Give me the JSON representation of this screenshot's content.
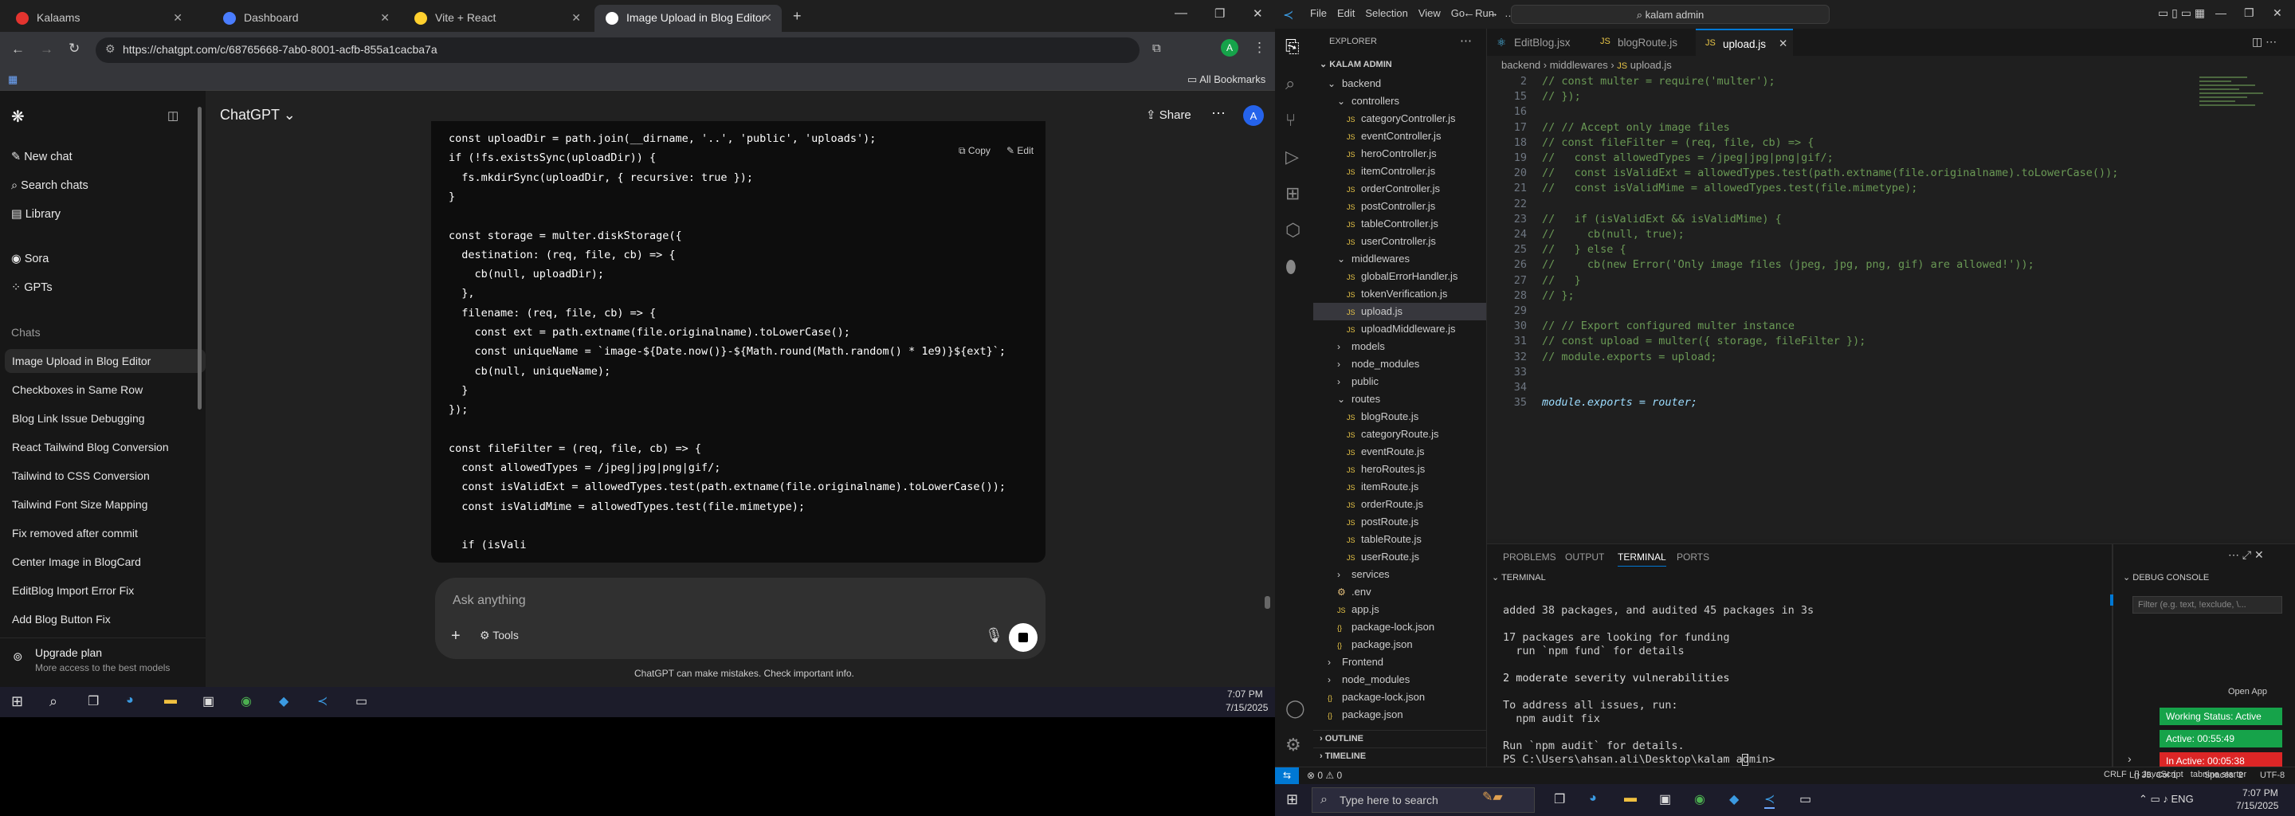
{
  "browser": {
    "tabs": [
      {
        "title": "Kalaams",
        "color": "#e3342f"
      },
      {
        "title": "Dashboard",
        "color": "#4a7dff"
      },
      {
        "title": "Vite + React",
        "color": "#ffd02e"
      },
      {
        "title": "Image Upload in Blog Editor",
        "color": "#ffffff"
      }
    ],
    "url": "https://chatgpt.com/c/68765668-7ab0-8001-acfb-855a1cacba7a",
    "all_bookmarks": "All Bookmarks"
  },
  "sidebar": {
    "nav": [
      "New chat",
      "Search chats",
      "Library",
      "Sora",
      "GPTs"
    ],
    "chats_heading": "Chats",
    "chats": [
      "Image Upload in Blog Editor",
      "Checkboxes in Same Row",
      "Blog Link Issue Debugging",
      "React Tailwind Blog Conversion",
      "Tailwind to CSS Conversion",
      "Tailwind Font Size Mapping",
      "Fix removed after commit",
      "Center Image in BlogCard",
      "EditBlog Import Error Fix",
      "Add Blog Button Fix"
    ],
    "upgrade_title": "Upgrade plan",
    "upgrade_sub": "More access to the best models"
  },
  "chatgpt": {
    "model": "ChatGPT",
    "share": "Share",
    "avatar": "A",
    "copy": "Copy",
    "edit": "Edit",
    "code_lines": [
      "const uploadDir = path.join(__dirname, '..', 'public', 'uploads');",
      "if (!fs.existsSync(uploadDir)) {",
      "  fs.mkdirSync(uploadDir, { recursive: true });",
      "}",
      "",
      "const storage = multer.diskStorage({",
      "  destination: (req, file, cb) => {",
      "    cb(null, uploadDir);",
      "  },",
      "  filename: (req, file, cb) => {",
      "    const ext = path.extname(file.originalname).toLowerCase();",
      "    const uniqueName = `image-${Date.now()}-${Math.round(Math.random() * 1e9)}${ext}`;",
      "    cb(null, uniqueName);",
      "  }",
      "});",
      "",
      "const fileFilter = (req, file, cb) => {",
      "  const allowedTypes = /jpeg|jpg|png|gif/;",
      "  const isValidExt = allowedTypes.test(path.extname(file.originalname).toLowerCase());",
      "  const isValidMime = allowedTypes.test(file.mimetype);",
      "",
      "  if (isVali"
    ],
    "input_placeholder": "Ask anything",
    "tools": "Tools",
    "disclaimer": "ChatGPT can make mistakes. Check important info."
  },
  "taskbar_left": {
    "time": "7:07 PM",
    "date": "7/15/2025"
  },
  "vscode": {
    "menu": [
      "File",
      "Edit",
      "Selection",
      "View",
      "Go",
      "Run",
      "…"
    ],
    "search": "kalam admin",
    "explorer_title": "EXPLORER",
    "workspace": "KALAM ADMIN",
    "tree": [
      {
        "label": "backend",
        "indent": 1,
        "kind": "folder-open"
      },
      {
        "label": "controllers",
        "indent": 2,
        "kind": "folder-open"
      },
      {
        "label": "categoryController.js",
        "indent": 3,
        "kind": "js"
      },
      {
        "label": "eventController.js",
        "indent": 3,
        "kind": "js"
      },
      {
        "label": "heroController.js",
        "indent": 3,
        "kind": "js"
      },
      {
        "label": "itemController.js",
        "indent": 3,
        "kind": "js"
      },
      {
        "label": "orderController.js",
        "indent": 3,
        "kind": "js"
      },
      {
        "label": "postController.js",
        "indent": 3,
        "kind": "js"
      },
      {
        "label": "tableController.js",
        "indent": 3,
        "kind": "js"
      },
      {
        "label": "userController.js",
        "indent": 3,
        "kind": "js"
      },
      {
        "label": "middlewares",
        "indent": 2,
        "kind": "folder-open"
      },
      {
        "label": "globalErrorHandler.js",
        "indent": 3,
        "kind": "js"
      },
      {
        "label": "tokenVerification.js",
        "indent": 3,
        "kind": "js"
      },
      {
        "label": "upload.js",
        "indent": 3,
        "kind": "js",
        "selected": true
      },
      {
        "label": "uploadMiddleware.js",
        "indent": 3,
        "kind": "js"
      },
      {
        "label": "models",
        "indent": 2,
        "kind": "folder"
      },
      {
        "label": "node_modules",
        "indent": 2,
        "kind": "folder"
      },
      {
        "label": "public",
        "indent": 2,
        "kind": "folder"
      },
      {
        "label": "routes",
        "indent": 2,
        "kind": "folder-open"
      },
      {
        "label": "blogRoute.js",
        "indent": 3,
        "kind": "js"
      },
      {
        "label": "categoryRoute.js",
        "indent": 3,
        "kind": "js"
      },
      {
        "label": "eventRoute.js",
        "indent": 3,
        "kind": "js"
      },
      {
        "label": "heroRoutes.js",
        "indent": 3,
        "kind": "js"
      },
      {
        "label": "itemRoute.js",
        "indent": 3,
        "kind": "js"
      },
      {
        "label": "orderRoute.js",
        "indent": 3,
        "kind": "js"
      },
      {
        "label": "postRoute.js",
        "indent": 3,
        "kind": "js"
      },
      {
        "label": "tableRoute.js",
        "indent": 3,
        "kind": "js"
      },
      {
        "label": "userRoute.js",
        "indent": 3,
        "kind": "js"
      },
      {
        "label": "services",
        "indent": 2,
        "kind": "folder"
      },
      {
        "label": ".env",
        "indent": 2,
        "kind": "env"
      },
      {
        "label": "app.js",
        "indent": 2,
        "kind": "js"
      },
      {
        "label": "package-lock.json",
        "indent": 2,
        "kind": "json"
      },
      {
        "label": "package.json",
        "indent": 2,
        "kind": "json"
      },
      {
        "label": "Frontend",
        "indent": 1,
        "kind": "folder"
      },
      {
        "label": "node_modules",
        "indent": 1,
        "kind": "folder"
      },
      {
        "label": "package-lock.json",
        "indent": 1,
        "kind": "json"
      },
      {
        "label": "package.json",
        "indent": 1,
        "kind": "json"
      }
    ],
    "outline": "OUTLINE",
    "timeline": "TIMELINE",
    "editor_tabs": [
      "EditBlog.jsx",
      "blogRoute.js",
      "upload.js"
    ],
    "breadcrumb": [
      "backend",
      "middlewares",
      "upload.js"
    ],
    "code": [
      {
        "n": "2",
        "t": "// const multer = require('multer');"
      },
      {
        "n": "15",
        "t": "// });"
      },
      {
        "n": "16",
        "t": ""
      },
      {
        "n": "17",
        "t": "// // Accept only image files"
      },
      {
        "n": "18",
        "t": "// const fileFilter = (req, file, cb) => {"
      },
      {
        "n": "19",
        "t": "//   const allowedTypes = /jpeg|jpg|png|gif/;"
      },
      {
        "n": "20",
        "t": "//   const isValidExt = allowedTypes.test(path.extname(file.originalname).toLowerCase());"
      },
      {
        "n": "21",
        "t": "//   const isValidMime = allowedTypes.test(file.mimetype);"
      },
      {
        "n": "22",
        "t": ""
      },
      {
        "n": "23",
        "t": "//   if (isValidExt && isValidMime) {"
      },
      {
        "n": "24",
        "t": "//     cb(null, true);"
      },
      {
        "n": "25",
        "t": "//   } else {"
      },
      {
        "n": "26",
        "t": "//     cb(new Error('Only image files (jpeg, jpg, png, gif) are allowed!'));"
      },
      {
        "n": "27",
        "t": "//   }"
      },
      {
        "n": "28",
        "t": "// };"
      },
      {
        "n": "29",
        "t": ""
      },
      {
        "n": "30",
        "t": "// // Export configured multer instance"
      },
      {
        "n": "31",
        "t": "// const upload = multer({ storage, fileFilter });"
      },
      {
        "n": "32",
        "t": "// module.exports = upload;"
      },
      {
        "n": "33",
        "t": ""
      },
      {
        "n": "34",
        "t": ""
      },
      {
        "n": "35",
        "t": "module.exports = router;"
      }
    ],
    "panel_tabs": [
      "PROBLEMS",
      "OUTPUT",
      "TERMINAL",
      "PORTS"
    ],
    "terminal_title": "TERMINAL",
    "debug_console": "DEBUG CONSOLE",
    "filter_placeholder": "Filter (e.g. text, !exclude, \\...",
    "terminal_lines": [
      "added 38 packages, and audited 45 packages in 3s",
      "",
      "17 packages are looking for funding",
      "  run `npm fund` for details",
      "",
      "2 moderate severity vulnerabilities",
      "",
      "To address all issues, run:",
      "  npm audit fix",
      "",
      "Run `npm audit` for details.",
      "PS C:\\Users\\ahsan.ali\\Desktop\\kalam admin> "
    ],
    "open_app": "Open App",
    "working_status": "Working Status: Active",
    "active_time": "Active: 00:55:49",
    "inactive_time": "In Active: 00:05:38",
    "status_left": "⊗ 0 ⚠ 0",
    "status_right": [
      "Ln 35, Col 1",
      "Spaces: 2",
      "UTF-8",
      "CRLF",
      "{} JavaScript",
      "tabnine starter"
    ]
  },
  "taskbar_right": {
    "search": "Type here to search",
    "time": "7:07 PM",
    "date": "7/15/2025"
  },
  "colors": {
    "accent": "#0078d4",
    "green": "#16a34a",
    "red": "#dc2626"
  }
}
